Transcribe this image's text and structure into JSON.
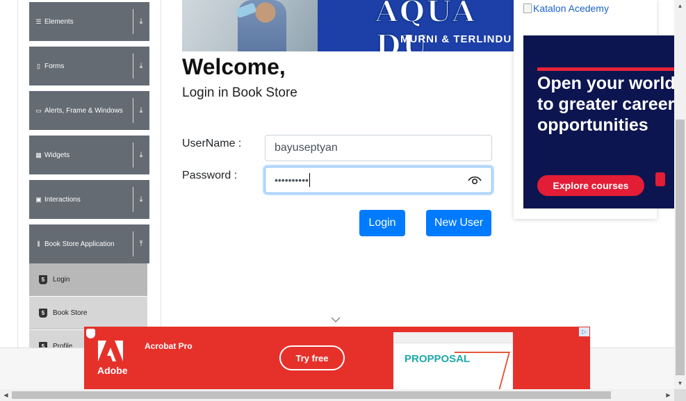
{
  "sidebar": {
    "groups": [
      {
        "label": "Elements",
        "icon": "list-icon",
        "arrow": "download-arrow-icon"
      },
      {
        "label": "Forms",
        "icon": "form-icon",
        "arrow": "download-arrow-icon"
      },
      {
        "label": "Alerts, Frame & Windows",
        "icon": "window-icon",
        "arrow": "download-arrow-icon"
      },
      {
        "label": "Widgets",
        "icon": "grid-icon",
        "arrow": "download-arrow-icon"
      },
      {
        "label": "Interactions",
        "icon": "square-icon",
        "arrow": "download-arrow-icon"
      },
      {
        "label": "Book Store Application",
        "icon": "books-icon",
        "arrow": "upload-arrow-icon"
      }
    ],
    "book_store_items": [
      {
        "label": "Login",
        "active": true
      },
      {
        "label": "Book Store",
        "active": false
      },
      {
        "label": "Profile",
        "active": false
      }
    ]
  },
  "top_ad": {
    "brand": "AQUA DU",
    "tagline": "MURNI & TERLINDU"
  },
  "main": {
    "title": "Welcome,",
    "subtitle": "Login in Book Store",
    "username_label": "UserName :",
    "username_value": "bayuseptyan",
    "password_label": "Password :",
    "password_value": "••••••••••",
    "login_button": "Login",
    "new_user_button": "New User"
  },
  "side_ad": {
    "broken_image_alt": "Katalon Acedemy",
    "headline_lines": [
      "Open your world",
      "to greater career",
      "opportunities"
    ],
    "cta": "Explore courses"
  },
  "bottom_ad": {
    "brand": "Adobe",
    "product": "Acrobat Pro",
    "cta": "Try free",
    "doc_title": "PROPPOSAL"
  },
  "colors": {
    "primary": "#007bff",
    "sidebar_header": "#646b73",
    "adobe_red": "#e6312b",
    "ad_navy": "#0d1550"
  }
}
